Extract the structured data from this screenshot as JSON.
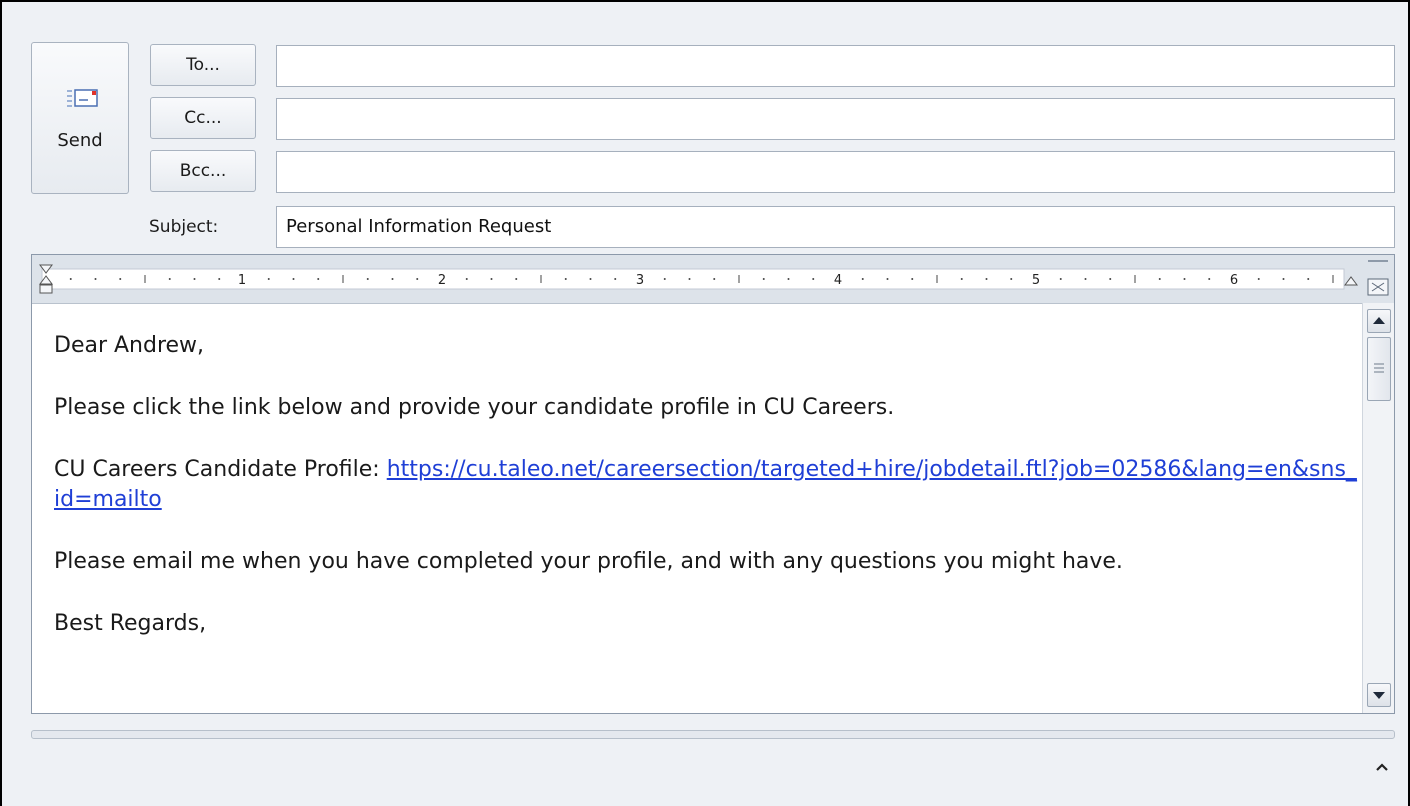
{
  "header": {
    "send_label": "Send",
    "to_label": "To...",
    "cc_label": "Cc...",
    "bcc_label": "Bcc...",
    "subject_label": "Subject:"
  },
  "fields": {
    "to_value": "",
    "cc_value": "",
    "bcc_value": "",
    "subject_value": "Personal Information Request"
  },
  "ruler": {
    "numbers": [
      "1",
      "2",
      "3",
      "4",
      "5",
      "6"
    ]
  },
  "message": {
    "greeting": "Dear Andrew,",
    "line1": "Please click the link below and provide your candidate profile in CU Careers.",
    "profile_label": "CU Careers Candidate Profile: ",
    "profile_link": "https://cu.taleo.net/careersection/targeted+hire/jobdetail.ftl?job=02586&lang=en&sns_id=mailto",
    "line3": "Please email me when you have completed your profile, and with any questions you might have.",
    "closing": "Best Regards,"
  },
  "icons": {
    "send": "envelope-send-icon",
    "scroll_up": "arrow-up-icon",
    "scroll_down": "arrow-down-icon",
    "expand": "chevron-up-icon"
  },
  "colors": {
    "link": "#1f3fd6",
    "chrome": "#eef1f5"
  }
}
